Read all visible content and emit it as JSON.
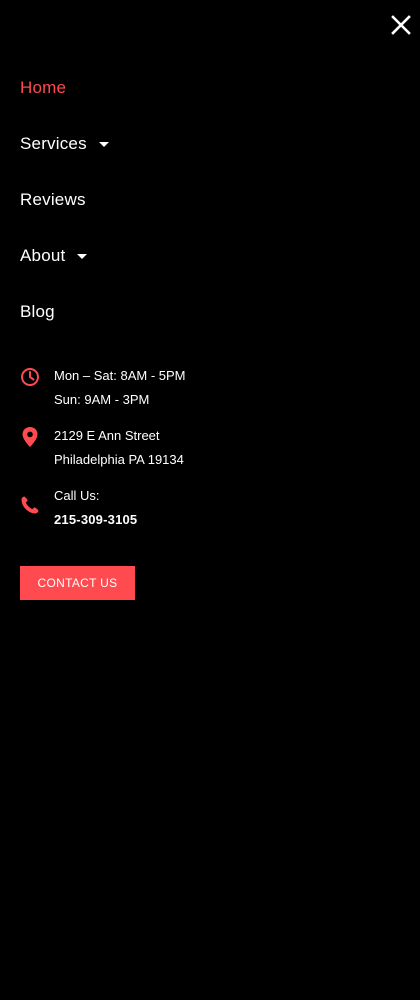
{
  "colors": {
    "accent": "#ff4a4f",
    "background": "#000000",
    "text": "#ffffff"
  },
  "close": {
    "icon": "close-icon"
  },
  "nav": {
    "items": [
      {
        "label": "Home",
        "active": true,
        "has_dropdown": false
      },
      {
        "label": "Services",
        "active": false,
        "has_dropdown": true
      },
      {
        "label": "Reviews",
        "active": false,
        "has_dropdown": false
      },
      {
        "label": "About",
        "active": false,
        "has_dropdown": true
      },
      {
        "label": "Blog",
        "active": false,
        "has_dropdown": false
      }
    ]
  },
  "info": {
    "hours": {
      "icon": "clock-icon",
      "line1": "Mon – Sat: 8AM - 5PM",
      "line2": "Sun: 9AM - 3PM"
    },
    "address": {
      "icon": "map-pin-icon",
      "line1": "2129 E Ann Street",
      "line2": "Philadelphia PA 19134"
    },
    "phone": {
      "icon": "phone-icon",
      "title": "Call Us:",
      "number": "215-309-3105"
    }
  },
  "cta": {
    "label": "CONTACT US"
  }
}
